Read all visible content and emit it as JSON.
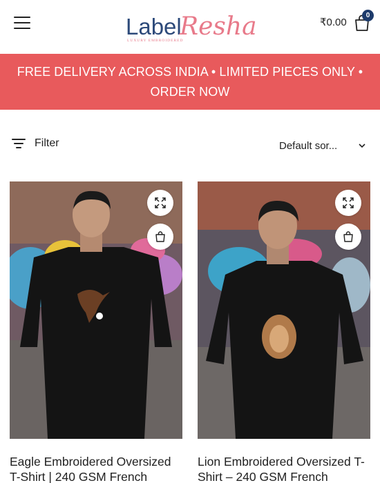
{
  "header": {
    "menu_icon": "hamburger-menu-icon",
    "logo": {
      "part_a": "Label",
      "part_b": "Resha",
      "subtitle": "LUXURY EMBROIDERED"
    },
    "cart": {
      "amount": "₹0.00",
      "count": "0",
      "icon": "shopping-bag-icon"
    }
  },
  "banner": {
    "text": "FREE DELIVERY ACROSS INDIA • LIMITED PIECES ONLY • ORDER NOW",
    "background": "#e85a5c"
  },
  "toolbar": {
    "filter_label": "Filter",
    "filter_icon": "filter-lines-icon",
    "sort_selected": "Default sor...",
    "sort_icon": "chevron-down-icon"
  },
  "products": [
    {
      "title": "Eagle Embroidered Oversized T-Shirt | 240 GSM French",
      "quick_view_icon": "expand-icon",
      "add_to_cart_icon": "bag-icon"
    },
    {
      "title": "Lion Embroidered Oversized T-Shirt – 240 GSM French",
      "quick_view_icon": "expand-icon",
      "add_to_cart_icon": "bag-icon"
    }
  ],
  "colors": {
    "brand_navy": "#2d4a7a",
    "brand_pink": "#e87a8a",
    "badge": "#1d3b6b"
  }
}
